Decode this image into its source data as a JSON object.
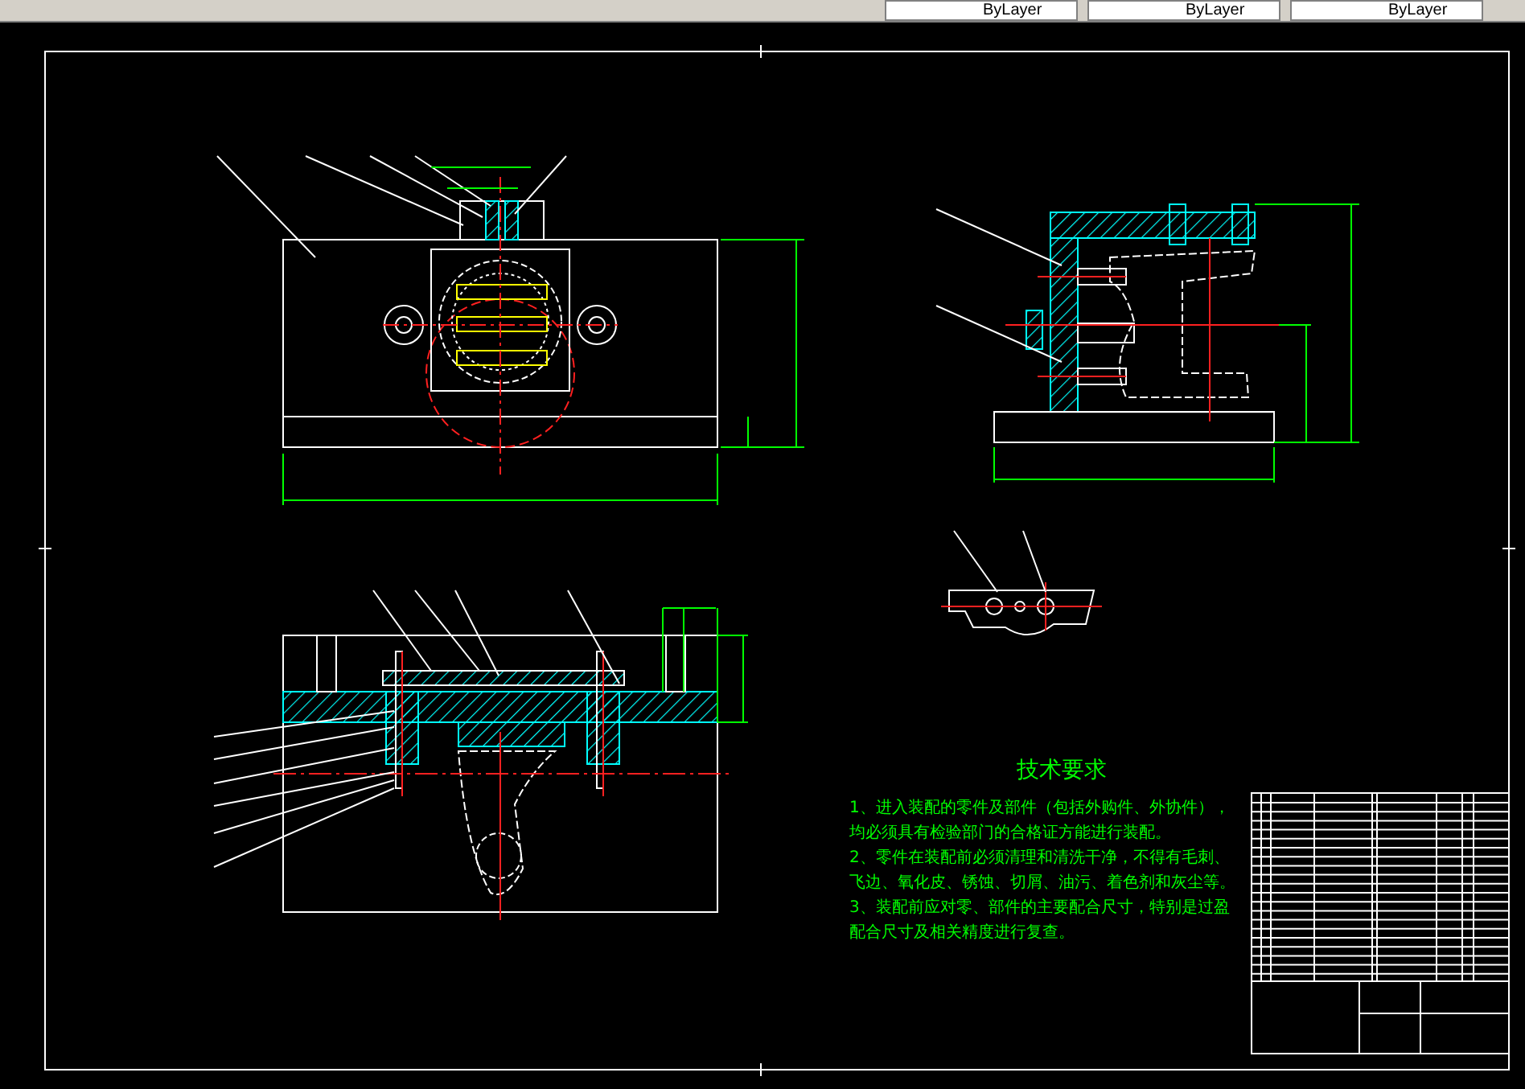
{
  "toolbar": {
    "dropdowns": [
      {
        "value": "ByLayer"
      },
      {
        "value": "ByLayer"
      },
      {
        "value": "ByLayer"
      }
    ]
  },
  "drawing": {
    "requirements": {
      "title": "技术要求",
      "lines": [
        "1、进入装配的零件及部件（包括外购件、外协件），",
        "均必须具有检验部门的合格证方能进行装配。",
        "2、零件在装配前必须清理和清洗干净，不得有毛刺、",
        "飞边、氧化皮、锈蚀、切屑、油污、着色剂和灰尘等。",
        "3、装配前应对零、部件的主要配合尺寸，特别是过盈",
        "配合尺寸及相关精度进行复查。"
      ]
    }
  }
}
